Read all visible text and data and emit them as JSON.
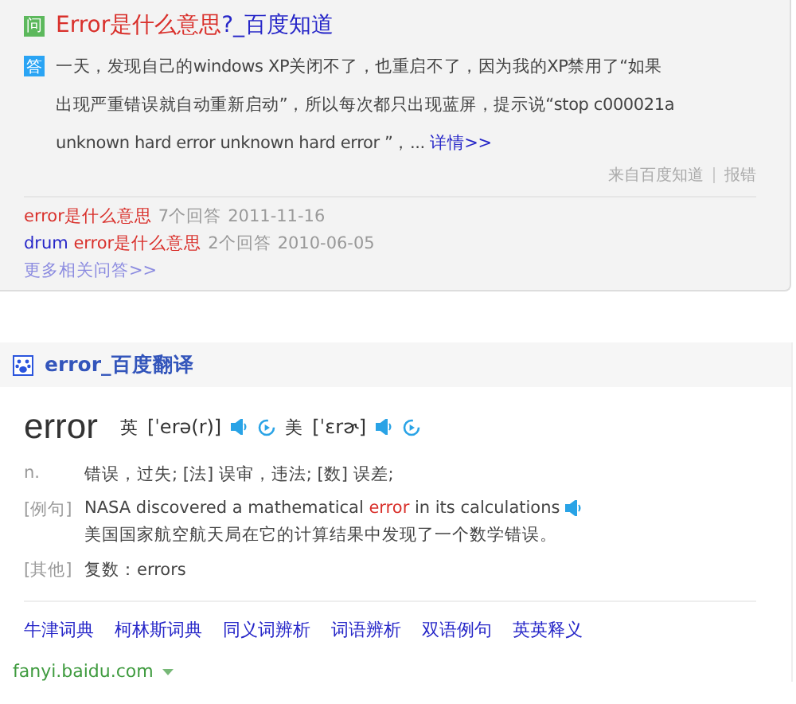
{
  "zhidao": {
    "q_badge": "问",
    "title": [
      {
        "text": "Error是什么意思",
        "highlight": true
      },
      {
        "text": "?_百度知道",
        "highlight": false
      }
    ],
    "a_badge": "答",
    "answer": " 一天，发现自己的windows XP关闭不了，也重启不了，因为我的XP禁用了“如果出现严重错误就自动重新启动”，所以每次都只出现蓝屏，提示说“stop c000021a unknown hard error unknown hard error ”，...",
    "details_link": "详情>>",
    "source": "来自百度知道",
    "report": "报错",
    "related": [
      {
        "parts": [
          {
            "text": "error是什么意思",
            "highlight": true
          }
        ],
        "answers": "7个回答",
        "date": "2011-11-16"
      },
      {
        "parts": [
          {
            "text": "drum",
            "highlight": false
          },
          {
            "text": "error是什么意思",
            "highlight": true
          }
        ],
        "answers": "2个回答",
        "date": "2010-06-05"
      }
    ],
    "more": "更多相关问答>>"
  },
  "fanyi": {
    "title": "error_百度翻译",
    "word": "error",
    "pron": [
      {
        "lang": "英",
        "ipa": "[ˈerə(r)]"
      },
      {
        "lang": "美",
        "ipa": "[ˈɛrɚ]"
      }
    ],
    "pos": "n.",
    "meaning": "错误，过失; [法] 误审，违法; [数] 误差;",
    "example_label": "[例句]",
    "example": [
      {
        "text": "NASA discovered a mathematical ",
        "highlight": false
      },
      {
        "text": "error",
        "highlight": true
      },
      {
        "text": " in its calculations",
        "highlight": false
      }
    ],
    "example_zh": "美国国家航空航天局在它的计算结果中发现了一个数学错误。",
    "other_label": "[其他]",
    "other": "复数：errors",
    "links": [
      "牛津词典",
      "柯林斯词典",
      "同义词辨析",
      "词语辨析",
      "双语例句",
      "英英释义"
    ],
    "url": "fanyi.baidu.com"
  }
}
